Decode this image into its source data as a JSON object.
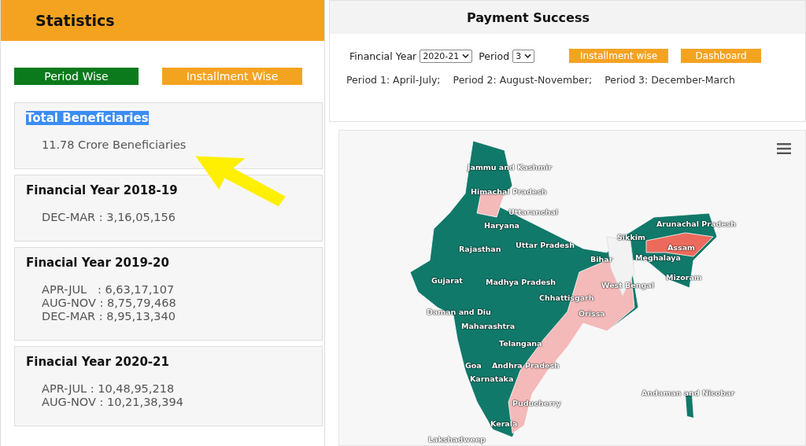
{
  "stats_panel": {
    "title": "Statistics",
    "tabs": [
      {
        "label": "Period Wise",
        "selected": true
      },
      {
        "label": "Installment Wise",
        "selected": false
      }
    ],
    "cards": [
      {
        "title": "Total Beneficiaries",
        "highlighted": true,
        "lines": [
          "11.78 Crore Beneficiaries"
        ]
      },
      {
        "title": "Financial Year 2018-19",
        "highlighted": false,
        "lines": [
          "DEC-MAR : 3,16,05,156"
        ]
      },
      {
        "title": "Finacial Year 2019-20",
        "highlighted": false,
        "lines": [
          "APR-JUL   : 6,63,17,107",
          "AUG-NOV : 8,75,79,468",
          "DEC-MAR : 8,95,13,340"
        ]
      },
      {
        "title": "Finacial Year 2020-21",
        "highlighted": false,
        "lines": [
          "APR-JUL : 10,48,95,218",
          "AUG-NOV : 10,21,38,394"
        ]
      }
    ]
  },
  "payment_panel": {
    "title": "Payment Success",
    "filters": [
      {
        "label": "Financial Year",
        "value": "2020-21"
      },
      {
        "label": "Period",
        "value": "3"
      }
    ],
    "buttons": [
      "Installment wise",
      "Dashboard"
    ],
    "periods": [
      "Period 1: April-July;",
      "Period 2: August-November;",
      "Period 3: December-March"
    ],
    "map": {
      "labels": [
        "Jammu and Kashmir",
        "Himachal Pradesh",
        "Uttaranchal",
        "Haryana",
        "Arunachal Pradesh",
        "Sikkim",
        "Rajasthan",
        "Uttar Pradesh",
        "Assam",
        "Bihar",
        "Meghalaya",
        "Gujarat",
        "Madhya Pradesh",
        "West Bengal",
        "Mizoram",
        "Chhattisgarh",
        "Daman and Diu",
        "Orissa",
        "Maharashtra",
        "Telangana",
        "Goa",
        "Andhra Pradesh",
        "Karnataka",
        "Andaman and Nicobar",
        "Puducherry",
        "Kerala",
        "Lakshadweep"
      ]
    }
  }
}
